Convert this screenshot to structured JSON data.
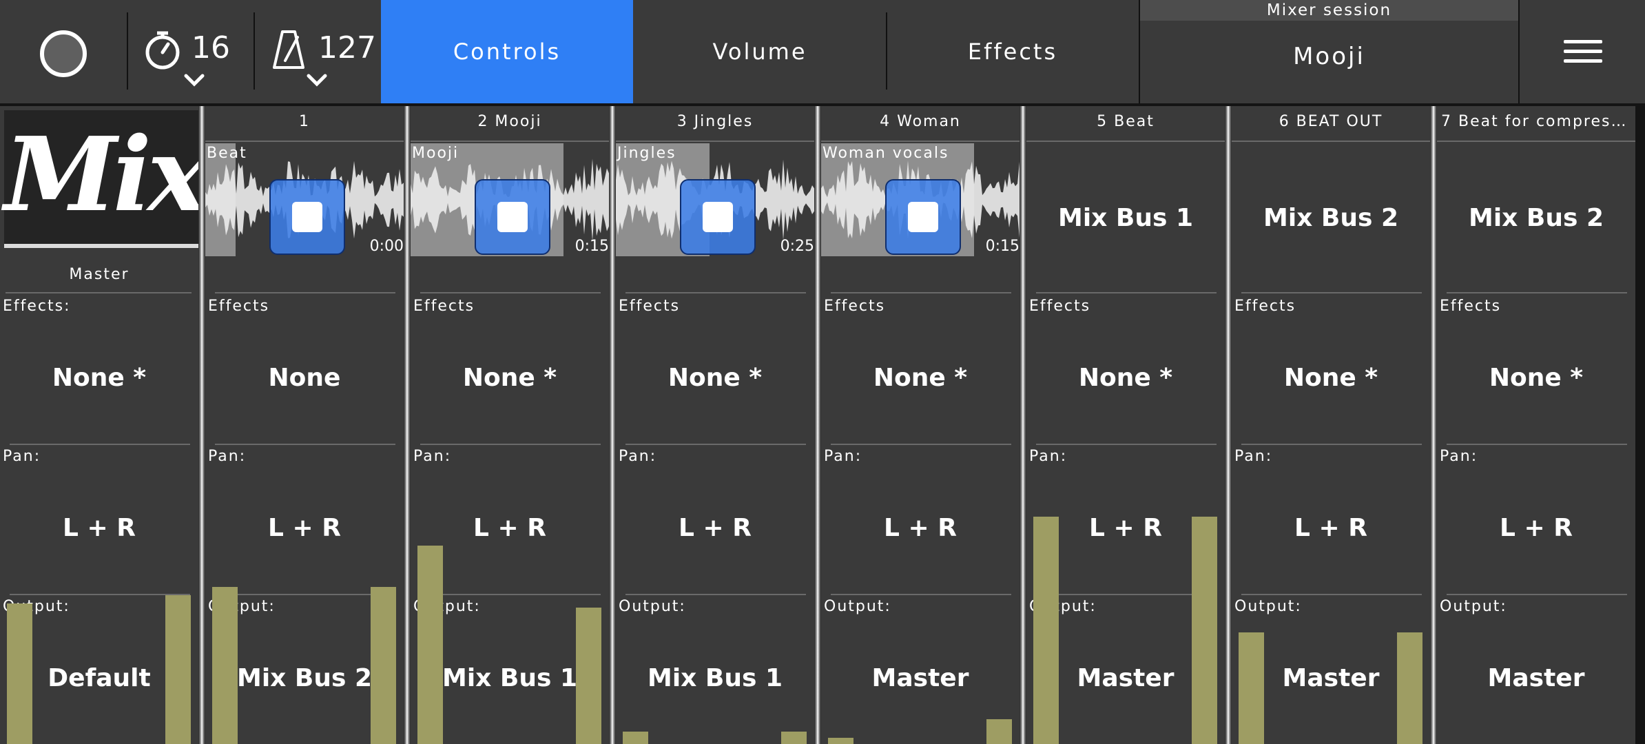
{
  "topbar": {
    "metronome_count": "16",
    "tempo": "127",
    "tabs": [
      {
        "label": "Controls",
        "active": true
      },
      {
        "label": "Volume",
        "active": false
      },
      {
        "label": "Effects",
        "active": false
      }
    ],
    "session_caption": "Mixer session",
    "session_name": "Mooji",
    "accent_color": "#2f7ff5"
  },
  "labels": {
    "effects": "Effects",
    "effects_colon": "Effects:",
    "pan": "Pan:",
    "output": "Output:"
  },
  "master": {
    "logo_text": "Mix",
    "name": "Master",
    "effects": "None *",
    "pan": "L + R",
    "output": "Default",
    "meter_left": 0.34,
    "meter_right": 0.36
  },
  "channels": [
    {
      "title": "1",
      "clip_name": "Beat",
      "clip_time": "0:00",
      "effects": "None",
      "pan": "L + R",
      "output": "Mix Bus 2",
      "meter_left": 0.38,
      "meter_right": 0.38
    },
    {
      "title": "2 Mooji",
      "clip_name": "Mooji",
      "clip_time": "0:15",
      "effects": "None *",
      "pan": "L + R",
      "output": "Mix Bus 1",
      "meter_left": 0.48,
      "meter_right": 0.33
    },
    {
      "title": "3 Jingles",
      "clip_name": "Jingles",
      "clip_time": "0:25",
      "effects": "None *",
      "pan": "L + R",
      "output": "Mix Bus 1",
      "meter_left": 0.03,
      "meter_right": 0.03
    },
    {
      "title": "4 Woman",
      "clip_name": "Woman vocals",
      "clip_time": "0:15",
      "effects": "None *",
      "pan": "L + R",
      "output": "Master",
      "meter_left": 0.015,
      "meter_right": 0.06
    },
    {
      "title": "5 Beat",
      "bus_name": "Mix Bus 1",
      "effects": "None *",
      "pan": "L + R",
      "output": "Master",
      "meter_left": 0.55,
      "meter_right": 0.55
    },
    {
      "title": "6 BEAT OUT",
      "bus_name": "Mix Bus 2",
      "effects": "None *",
      "pan": "L + R",
      "output": "Master",
      "meter_left": 0.27,
      "meter_right": 0.27
    },
    {
      "title": "7 Beat for compress…",
      "bus_name": "Mix Bus 2",
      "effects": "None *",
      "pan": "L + R",
      "output": "Master",
      "meter_left": 0,
      "meter_right": 0
    }
  ]
}
